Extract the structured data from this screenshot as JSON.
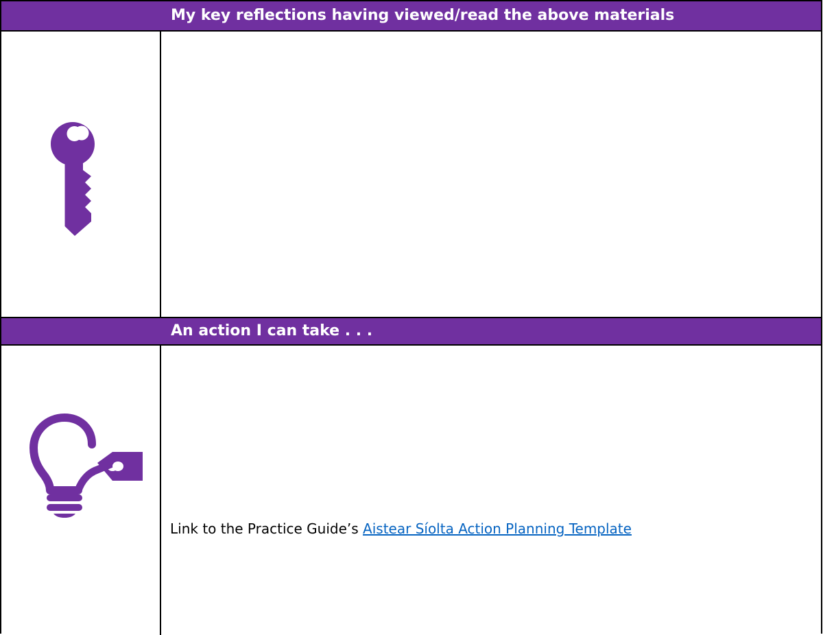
{
  "sections": [
    {
      "heading": "My key reflections having viewed/read the above materials",
      "icon": "key-icon"
    },
    {
      "heading": "An action I can take . . .",
      "icon": "lightbulb-tag-icon",
      "link_prefix": "Link to the Practice Guide’s ",
      "link_text": "Aistear Síolta Action Planning Template"
    }
  ],
  "colors": {
    "header_bg": "#7030a0",
    "icon": "#7030a0",
    "link": "#0563c1"
  }
}
